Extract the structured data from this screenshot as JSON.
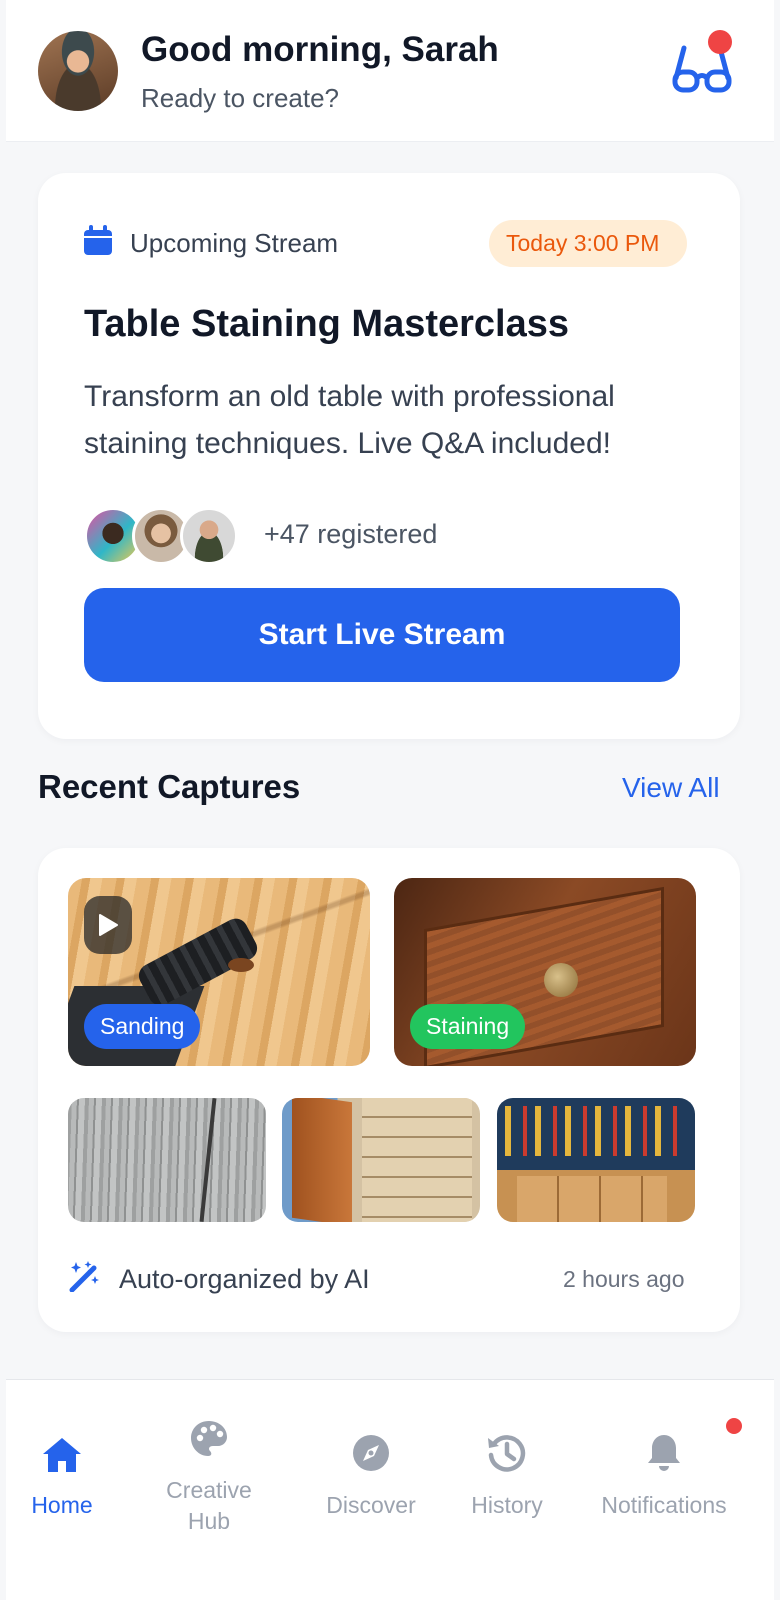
{
  "header": {
    "greeting": "Good morning, Sarah",
    "subtitle": "Ready to create?",
    "glasses_icon": "glasses-icon",
    "notification_dot_color": "#ef4444"
  },
  "stream": {
    "label": "Upcoming Stream",
    "time_badge": "Today 3:00 PM",
    "title": "Table Staining Masterclass",
    "description": "Transform an old table with professional staining techniques. Live Q&A included!",
    "registered": "+47 registered",
    "button_label": "Start Live Stream",
    "calendar_icon": "calendar-icon"
  },
  "recent": {
    "title": "Recent Captures",
    "view_all": "View All",
    "tags": {
      "sanding": "Sanding",
      "staining": "Staining"
    },
    "footer_label": "Auto-organized by AI",
    "footer_time": "2 hours ago",
    "ai_icon": "magic-wand-icon"
  },
  "nav": {
    "home": "Home",
    "creative_hub": "Creative Hub",
    "discover": "Discover",
    "history": "History",
    "notifications": "Notifications"
  },
  "colors": {
    "primary": "#2563eb",
    "badge_bg": "#ffedd5",
    "badge_text": "#ea580c",
    "staining_tag": "#22c55e",
    "alert": "#ef4444"
  }
}
